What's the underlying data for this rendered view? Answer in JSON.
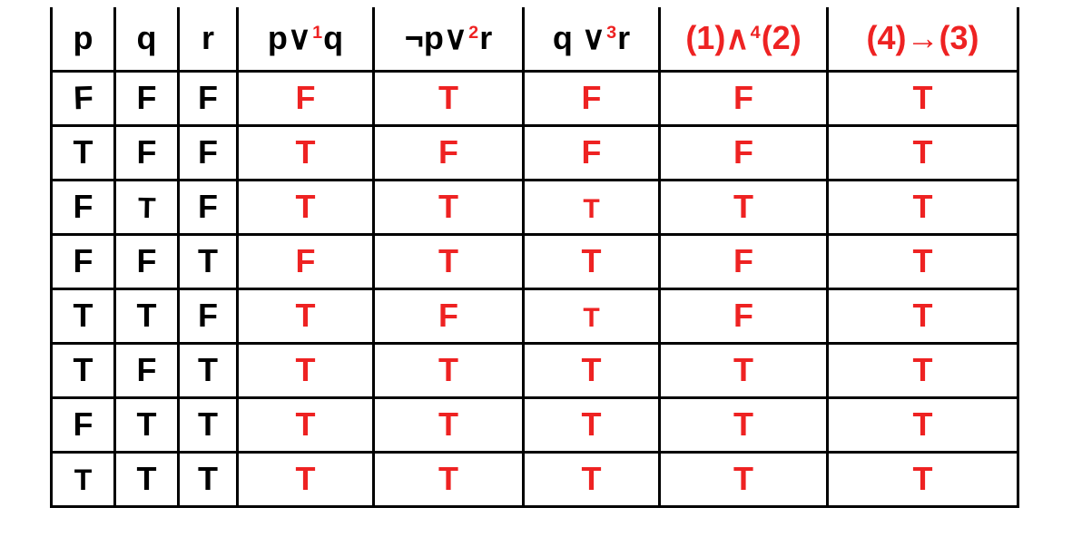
{
  "headers": {
    "p": "p",
    "q": "q",
    "r": "r",
    "c1_pre": "p∨",
    "c1_sup": "1",
    "c1_post": "q",
    "c2_pre": "¬p∨",
    "c2_sup": "2",
    "c2_post": "r",
    "c3_pre": "q ∨",
    "c3_sup": "3",
    "c3_post": "r",
    "c4_pre": "(1)∧",
    "c4_sup": "4",
    "c4_post": "(2)",
    "c5": "(4)→(3)"
  },
  "rows": [
    {
      "p": "F",
      "q": "F",
      "r": "F",
      "c1": "F",
      "c2": "T",
      "c3": "F",
      "c4": "F",
      "c5": "T"
    },
    {
      "p": "T",
      "q": "F",
      "r": "F",
      "c1": "T",
      "c2": "F",
      "c3": "F",
      "c4": "F",
      "c5": "T"
    },
    {
      "p": "F",
      "q": "T",
      "r": "F",
      "c1": "T",
      "c2": "T",
      "c3": "T",
      "c4": "T",
      "c5": "T"
    },
    {
      "p": "F",
      "q": "F",
      "r": "T",
      "c1": "F",
      "c2": "T",
      "c3": "T",
      "c4": "F",
      "c5": "T"
    },
    {
      "p": "T",
      "q": "T",
      "r": "F",
      "c1": "T",
      "c2": "F",
      "c3": "T",
      "c4": "F",
      "c5": "T"
    },
    {
      "p": "T",
      "q": "F",
      "r": "T",
      "c1": "T",
      "c2": "T",
      "c3": "T",
      "c4": "T",
      "c5": "T"
    },
    {
      "p": "F",
      "q": "T",
      "r": "T",
      "c1": "T",
      "c2": "T",
      "c3": "T",
      "c4": "T",
      "c5": "T"
    },
    {
      "p": "T",
      "q": "T",
      "r": "T",
      "c1": "T",
      "c2": "T",
      "c3": "T",
      "c4": "T",
      "c5": "T"
    }
  ]
}
